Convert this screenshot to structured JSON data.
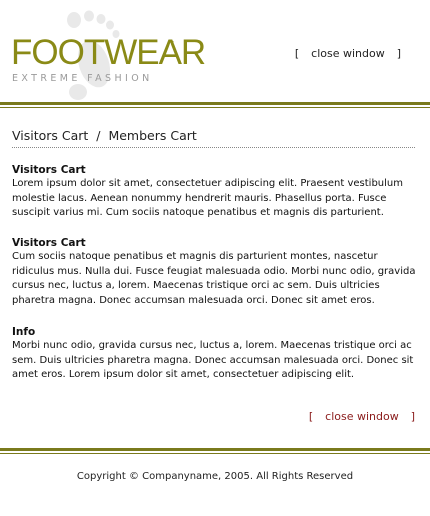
{
  "header": {
    "logo_main": "FOOTWEAR",
    "logo_tm": "™",
    "logo_sub": "EXTREME FASHION",
    "close_window_label": "close window",
    "bracket_open": "[",
    "bracket_close": "]"
  },
  "content": {
    "page_title": "Visitors Cart  /  Members Cart",
    "sections": [
      {
        "heading": "Visitors Cart",
        "body": "Lorem ipsum dolor sit amet, consectetuer adipiscing elit. Praesent vestibulum molestie lacus. Aenean nonummy hendrerit mauris. Phasellus porta. Fusce suscipit varius mi. Cum sociis natoque penatibus et magnis dis parturient."
      },
      {
        "heading": "Visitors Cart",
        "body": "Cum sociis natoque penatibus et magnis dis parturient montes, nascetur ridiculus mus. Nulla dui. Fusce feugiat malesuada odio. Morbi nunc odio, gravida cursus nec, luctus a, lorem. Maecenas tristique orci ac sem. Duis ultricies pharetra magna. Donec accumsan malesuada orci. Donec sit amet eros."
      },
      {
        "heading": "Info",
        "body": "Morbi nunc odio, gravida cursus nec, luctus a, lorem. Maecenas tristique orci ac sem. Duis ultricies pharetra magna. Donec accumsan malesuada orci. Donec sit amet eros. Lorem ipsum dolor sit amet, consectetuer adipiscing elit."
      }
    ],
    "close_window_label": "close window"
  },
  "footer": {
    "copyright": "Copyright © Companyname, 2005. All Rights Reserved"
  },
  "colors": {
    "brand_olive": "#8a8a16",
    "rule_olive": "#7a7a1c",
    "link_maroon": "#8a1a1a",
    "subtitle_gray": "#9a9a9a"
  },
  "icons": {
    "logo_background": "footprint-icon"
  }
}
